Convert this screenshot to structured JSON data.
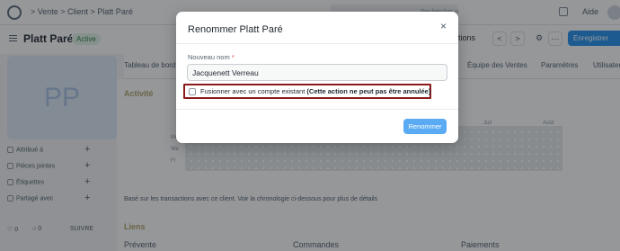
{
  "navbar": {
    "breadcrumb": "> Vente > Client > Platt Paré",
    "search_hint": "Rechercher ou tapez (Ctrl + G)",
    "help_label": "Aide"
  },
  "header": {
    "title": "Platt Paré",
    "status": "Active",
    "actions_label": "tions",
    "prev": "<",
    "next": ">",
    "save_label": "Enregistrer"
  },
  "sidebar": {
    "avatar_initials": "PP",
    "items": [
      {
        "label": "Attribué à"
      },
      {
        "label": "Pièces jointes"
      },
      {
        "label": "Étiquettes"
      },
      {
        "label": "Partagé avec"
      }
    ],
    "likes": "0",
    "comments": "0",
    "follow_label": "SUIVRE"
  },
  "tabs": [
    {
      "label": "Tableau de bord"
    },
    {
      "label": "Équipe des Ventes"
    },
    {
      "label": "Paramètres"
    },
    {
      "label": "Utilisateur"
    }
  ],
  "activity": {
    "heading": "Activité",
    "days": [
      "Mo",
      "We",
      "Fr"
    ],
    "months": [
      "Juil",
      "Août"
    ],
    "note": "Basé sur les transactions avec ce client. Voir la chronologie ci-dessous pour plus de détails"
  },
  "links": {
    "heading": "Liens",
    "columns": [
      "Prévente",
      "Commandes",
      "Paiements"
    ]
  },
  "modal": {
    "title": "Renommer Platt Paré",
    "field_label": "Nouveau nom",
    "required_mark": "*",
    "field_value": "Jacquenett Verreau",
    "checkbox_label": "Fusionner avec un compte existant",
    "checkbox_warning": "(Cette action ne peut pas être annulée)",
    "checkbox_checked": false,
    "submit_label": "Renommer",
    "close_label": "×"
  },
  "colors": {
    "primary": "#2490ef",
    "highlight_border": "#8b1a1a",
    "section_title": "#b2a56c"
  }
}
